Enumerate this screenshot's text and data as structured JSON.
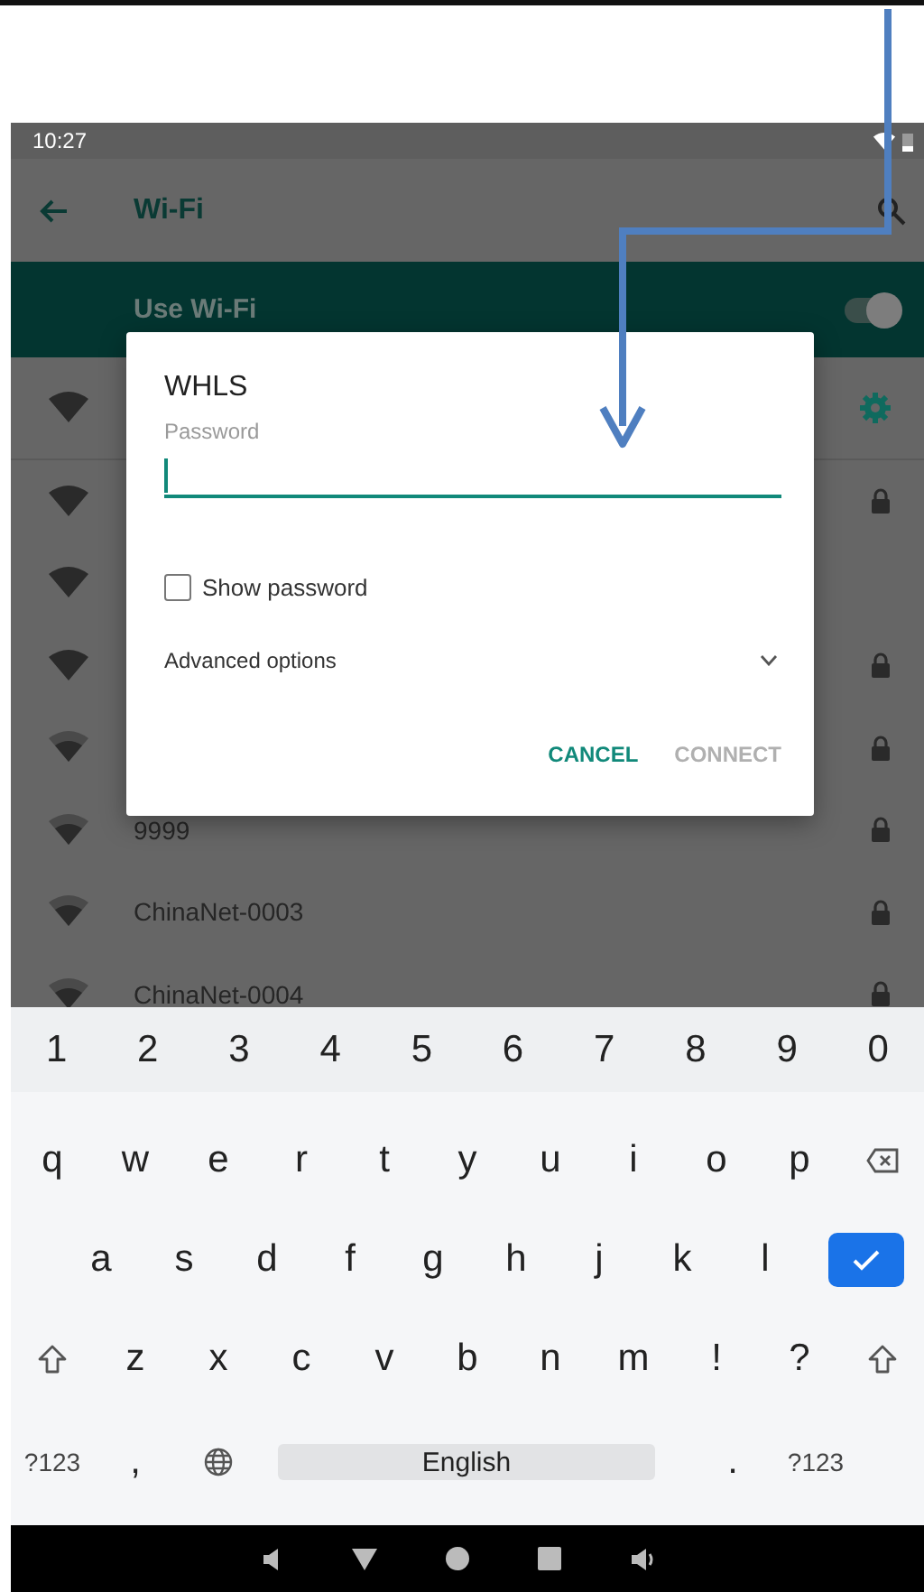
{
  "status_bar": {
    "time": "10:27"
  },
  "toolbar": {
    "title": "Wi-Fi"
  },
  "wifi_switch": {
    "label": "Use Wi-Fi",
    "on": true
  },
  "networks": [
    {
      "weak": false,
      "secured": false,
      "connected": true
    },
    {
      "weak": false,
      "secured": true,
      "connected": false
    },
    {
      "weak": false,
      "secured": false,
      "connected": false
    },
    {
      "weak": false,
      "secured": true,
      "connected": false
    },
    {
      "weak": true,
      "secured": true,
      "connected": false
    },
    {
      "name": "9999",
      "weak": true,
      "secured": true,
      "connected": false
    },
    {
      "name": "ChinaNet-0003",
      "weak": true,
      "secured": true,
      "connected": false
    },
    {
      "name": "ChinaNet-0004",
      "weak": true,
      "secured": true,
      "connected": false
    }
  ],
  "dialog": {
    "title": "WHLS",
    "password_label": "Password",
    "show_password": {
      "label": "Show password",
      "checked": false
    },
    "advanced": {
      "label": "Advanced options",
      "expanded": false
    },
    "buttons": [
      {
        "label": "CANCEL",
        "disabled": false
      },
      {
        "label": "CONNECT",
        "disabled": true
      }
    ]
  },
  "keyboard": {
    "number_keys": [
      {
        "kind": "char",
        "label": "1"
      },
      {
        "kind": "char",
        "label": "2"
      },
      {
        "kind": "char",
        "label": "3"
      },
      {
        "kind": "char",
        "label": "4"
      },
      {
        "kind": "char",
        "label": "5"
      },
      {
        "kind": "char",
        "label": "6"
      },
      {
        "kind": "char",
        "label": "7"
      },
      {
        "kind": "char",
        "label": "8"
      },
      {
        "kind": "char",
        "label": "9"
      },
      {
        "kind": "char",
        "label": "0"
      }
    ],
    "top_letter_keys": [
      {
        "kind": "char",
        "label": "q"
      },
      {
        "kind": "char",
        "label": "w"
      },
      {
        "kind": "char",
        "label": "e"
      },
      {
        "kind": "char",
        "label": "r"
      },
      {
        "kind": "char",
        "label": "t"
      },
      {
        "kind": "char",
        "label": "y"
      },
      {
        "kind": "char",
        "label": "u"
      },
      {
        "kind": "char",
        "label": "i"
      },
      {
        "kind": "char",
        "label": "o"
      },
      {
        "kind": "char",
        "label": "p"
      },
      {
        "kind": "backspace"
      }
    ],
    "middle_letter_keys": [
      {
        "kind": "char",
        "label": "a"
      },
      {
        "kind": "char",
        "label": "s"
      },
      {
        "kind": "char",
        "label": "d"
      },
      {
        "kind": "char",
        "label": "f"
      },
      {
        "kind": "char",
        "label": "g"
      },
      {
        "kind": "char",
        "label": "h"
      },
      {
        "kind": "char",
        "label": "j"
      },
      {
        "kind": "char",
        "label": "k"
      },
      {
        "kind": "char",
        "label": "l"
      },
      {
        "kind": "enter"
      }
    ],
    "bottom_letter_keys": [
      {
        "kind": "shift"
      },
      {
        "kind": "char",
        "label": "z"
      },
      {
        "kind": "char",
        "label": "x"
      },
      {
        "kind": "char",
        "label": "c"
      },
      {
        "kind": "char",
        "label": "v"
      },
      {
        "kind": "char",
        "label": "b"
      },
      {
        "kind": "char",
        "label": "n"
      },
      {
        "kind": "char",
        "label": "m"
      },
      {
        "kind": "char",
        "label": "!"
      },
      {
        "kind": "char",
        "label": "?"
      },
      {
        "kind": "shift"
      }
    ],
    "function_keys": [
      {
        "kind": "mode",
        "label": "?123"
      },
      {
        "kind": "char",
        "label": ","
      },
      {
        "kind": "globe"
      },
      {
        "kind": "space",
        "label": "English"
      },
      {
        "kind": "char",
        "label": "."
      },
      {
        "kind": "mode",
        "label": "?123"
      }
    ]
  }
}
